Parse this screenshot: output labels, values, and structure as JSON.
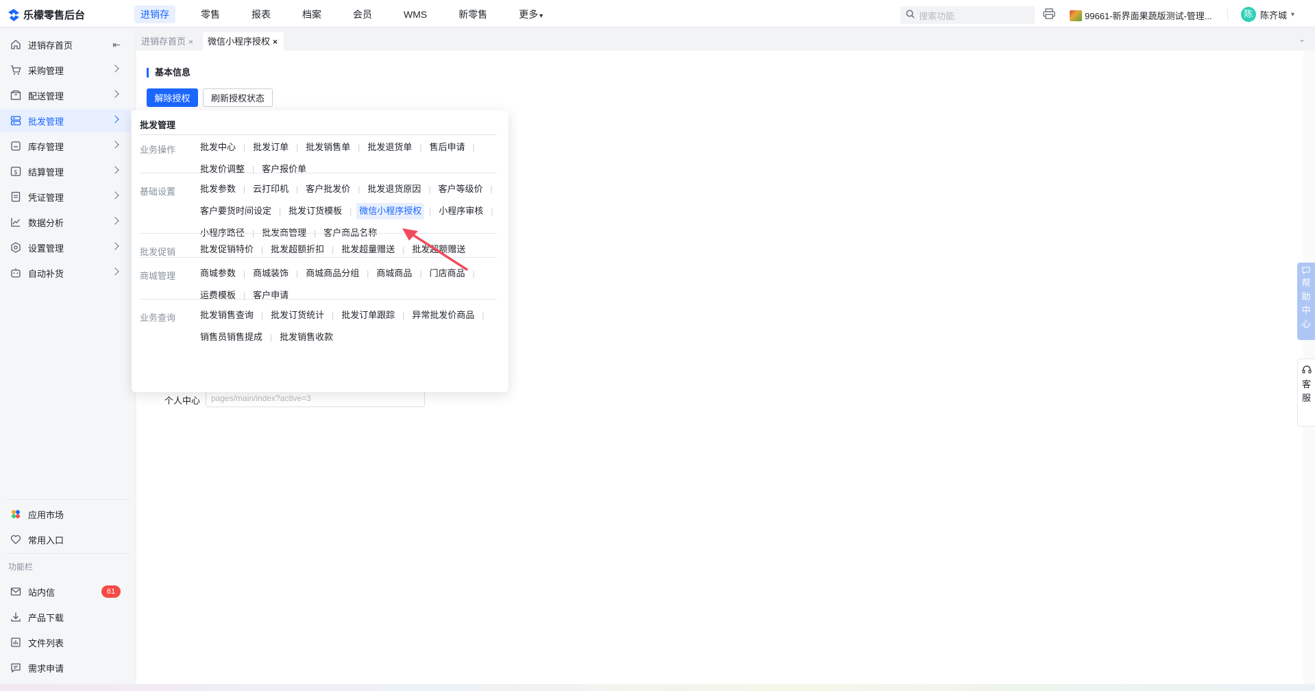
{
  "app": {
    "title": "乐檬零售后台"
  },
  "top_nav": [
    {
      "label": "进销存",
      "active": true
    },
    {
      "label": "零售"
    },
    {
      "label": "报表"
    },
    {
      "label": "档案"
    },
    {
      "label": "会员"
    },
    {
      "label": "WMS"
    },
    {
      "label": "新零售"
    },
    {
      "label": "更多",
      "dropdown": true
    }
  ],
  "search": {
    "placeholder": "搜索功能"
  },
  "store": {
    "name": "99661-新界面果蔬版测试-管理..."
  },
  "user": {
    "avatar_char": "陈",
    "name": "陈齐城"
  },
  "sidebar": {
    "items": [
      {
        "label": "进销存首页",
        "icon": "home-icon"
      },
      {
        "label": "采购管理",
        "icon": "cart-icon"
      },
      {
        "label": "配送管理",
        "icon": "package-icon"
      },
      {
        "label": "批发管理",
        "icon": "server-icon",
        "active": true
      },
      {
        "label": "库存管理",
        "icon": "inventory-icon"
      },
      {
        "label": "结算管理",
        "icon": "dollar-icon"
      },
      {
        "label": "凭证管理",
        "icon": "document-icon"
      },
      {
        "label": "数据分析",
        "icon": "chart-icon"
      },
      {
        "label": "设置管理",
        "icon": "settings-icon"
      },
      {
        "label": "自动补货",
        "icon": "robot-icon"
      }
    ],
    "bottom_items": [
      {
        "label": "应用市场",
        "icon": "app-market-icon"
      },
      {
        "label": "常用入口",
        "icon": "heart-icon"
      }
    ],
    "section_label": "功能栏",
    "function_items": [
      {
        "label": "站内信",
        "icon": "mail-icon",
        "badge": "61"
      },
      {
        "label": "产品下载",
        "icon": "download-icon"
      },
      {
        "label": "文件列表",
        "icon": "file-list-icon"
      },
      {
        "label": "需求申请",
        "icon": "request-icon"
      }
    ]
  },
  "tabs": [
    {
      "label": "进销存首页",
      "active": false
    },
    {
      "label": "微信小程序授权",
      "active": true
    }
  ],
  "main": {
    "section_title": "基本信息",
    "unbind_button": "解除授权",
    "refresh_button": "刷新授权状态",
    "personal_center_label": "个人中心",
    "personal_center_value": "pages/main/index?active=3"
  },
  "mega_menu": {
    "title": "批发管理",
    "groups": [
      {
        "label": "业务操作",
        "links": [
          "批发中心",
          "批发订单",
          "批发销售单",
          "批发退货单",
          "售后申请",
          "批发价调整",
          "客户报价单"
        ]
      },
      {
        "label": "基础设置",
        "links": [
          "批发参数",
          "云打印机",
          "客户批发价",
          "批发退货原因",
          "客户等级价",
          "客户要货时间设定",
          "批发订货模板",
          "微信小程序授权",
          "小程序审核",
          "小程序路径",
          "批发商管理",
          "客户商品名称"
        ],
        "current": "微信小程序授权"
      },
      {
        "label": "批发促销",
        "links": [
          "批发促销特价",
          "批发超额折扣",
          "批发超量赠送",
          "批发超额赠送"
        ]
      },
      {
        "label": "商城管理",
        "links": [
          "商城参数",
          "商城装饰",
          "商城商品分组",
          "商城商品",
          "门店商品",
          "运费模板",
          "客户申请"
        ]
      },
      {
        "label": "业务查询",
        "links": [
          "批发销售查询",
          "批发订货统计",
          "批发订单跟踪",
          "异常批发价商品",
          "销售员销售提成",
          "批发销售收款"
        ]
      }
    ]
  },
  "help_panel": {
    "chars": [
      "帮",
      "助",
      "中",
      "心"
    ]
  },
  "service_panel": {
    "chars": [
      "客",
      "服"
    ]
  },
  "colors": {
    "accent": "#1a66ff",
    "badge": "#f54a45",
    "arrow": "#f04b5d"
  }
}
